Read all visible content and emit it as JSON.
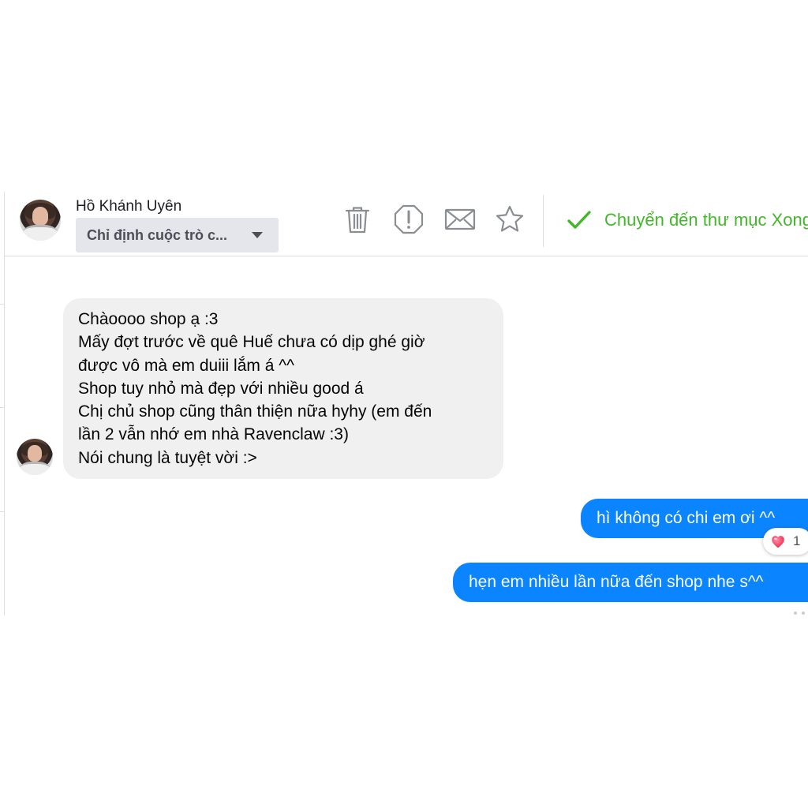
{
  "header": {
    "contact_name": "Hồ Khánh Uyên",
    "assign_select": {
      "selected": "Chỉ định cuộc trò c..."
    },
    "tools": {
      "icons": [
        "trash-icon",
        "spam-alert-icon",
        "mail-icon",
        "star-icon"
      ]
    },
    "done_action": {
      "label": "Chuyển đến thư mục Xong",
      "icon": "checkmark-icon"
    }
  },
  "thread": {
    "incoming": {
      "lines": [
        "Chàoooo shop ạ :3",
        "Mấy đợt trước về quê Huế chưa có dịp ghé giờ",
        "được vô mà em duiii lắm á ^^",
        "Shop tuy nhỏ mà đẹp với nhiều good á",
        "Chị chủ shop cũng thân thiện nữa hyhy (em đến",
        "lần 2 vẫn nhớ em nhà Ravenclaw :3)",
        "Nói chung là tuyệt vời :>"
      ]
    },
    "outgoing": [
      {
        "text": "hì không có chi em ơi ^^",
        "reaction": {
          "icon": "heart-icon",
          "count": "1"
        }
      },
      {
        "text": "hẹn em nhiều lần nữa đến shop nhe s^^"
      }
    ]
  },
  "colors": {
    "accent": "#0a84ff",
    "done_green": "#42b72a",
    "incoming_bubble": "#f0f0f0",
    "icon_gray": "#8a8d91"
  }
}
